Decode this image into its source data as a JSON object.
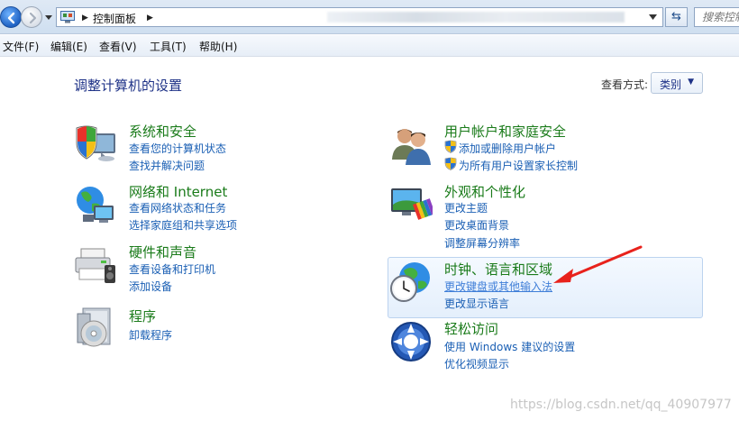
{
  "address_bar": {
    "breadcrumb": "控制面板",
    "search_placeholder": "搜索控制"
  },
  "menu": [
    "文件(F)",
    "编辑(E)",
    "查看(V)",
    "工具(T)",
    "帮助(H)"
  ],
  "main": {
    "title": "调整计算机的设置",
    "view_by_label": "查看方式:",
    "view_by_value": "类别"
  },
  "categories": [
    {
      "title": "系统和安全",
      "links": [
        "查看您的计算机状态",
        "查找并解决问题"
      ],
      "icon": "shield-monitor-icon"
    },
    {
      "title": "网络和 Internet",
      "links": [
        "查看网络状态和任务",
        "选择家庭组和共享选项"
      ],
      "icon": "network-globe-icon"
    },
    {
      "title": "硬件和声音",
      "links": [
        "查看设备和打印机",
        "添加设备"
      ],
      "icon": "printer-icon"
    },
    {
      "title": "程序",
      "links": [
        "卸载程序"
      ],
      "icon": "programs-disc-icon"
    },
    {
      "title": "用户帐户和家庭安全",
      "links": [
        "添加或删除用户帐户",
        "为所有用户设置家长控制"
      ],
      "icon": "users-icon"
    },
    {
      "title": "外观和个性化",
      "links": [
        "更改主题",
        "更改桌面背景",
        "调整屏幕分辨率"
      ],
      "icon": "monitor-palette-icon"
    },
    {
      "title": "时钟、语言和区域",
      "links": [
        "更改键盘或其他输入法",
        "更改显示语言"
      ],
      "icon": "clock-globe-icon"
    },
    {
      "title": "轻松访问",
      "links": [
        "使用 Windows 建议的设置",
        "优化视频显示"
      ],
      "icon": "ease-of-access-icon"
    }
  ],
  "watermark": "https://blog.csdn.net/qq_40907977",
  "colors": {
    "title": "#1e3287",
    "category": "#1a7b1a",
    "link": "#1a5fb4",
    "annotation_arrow": "#e8221c"
  }
}
